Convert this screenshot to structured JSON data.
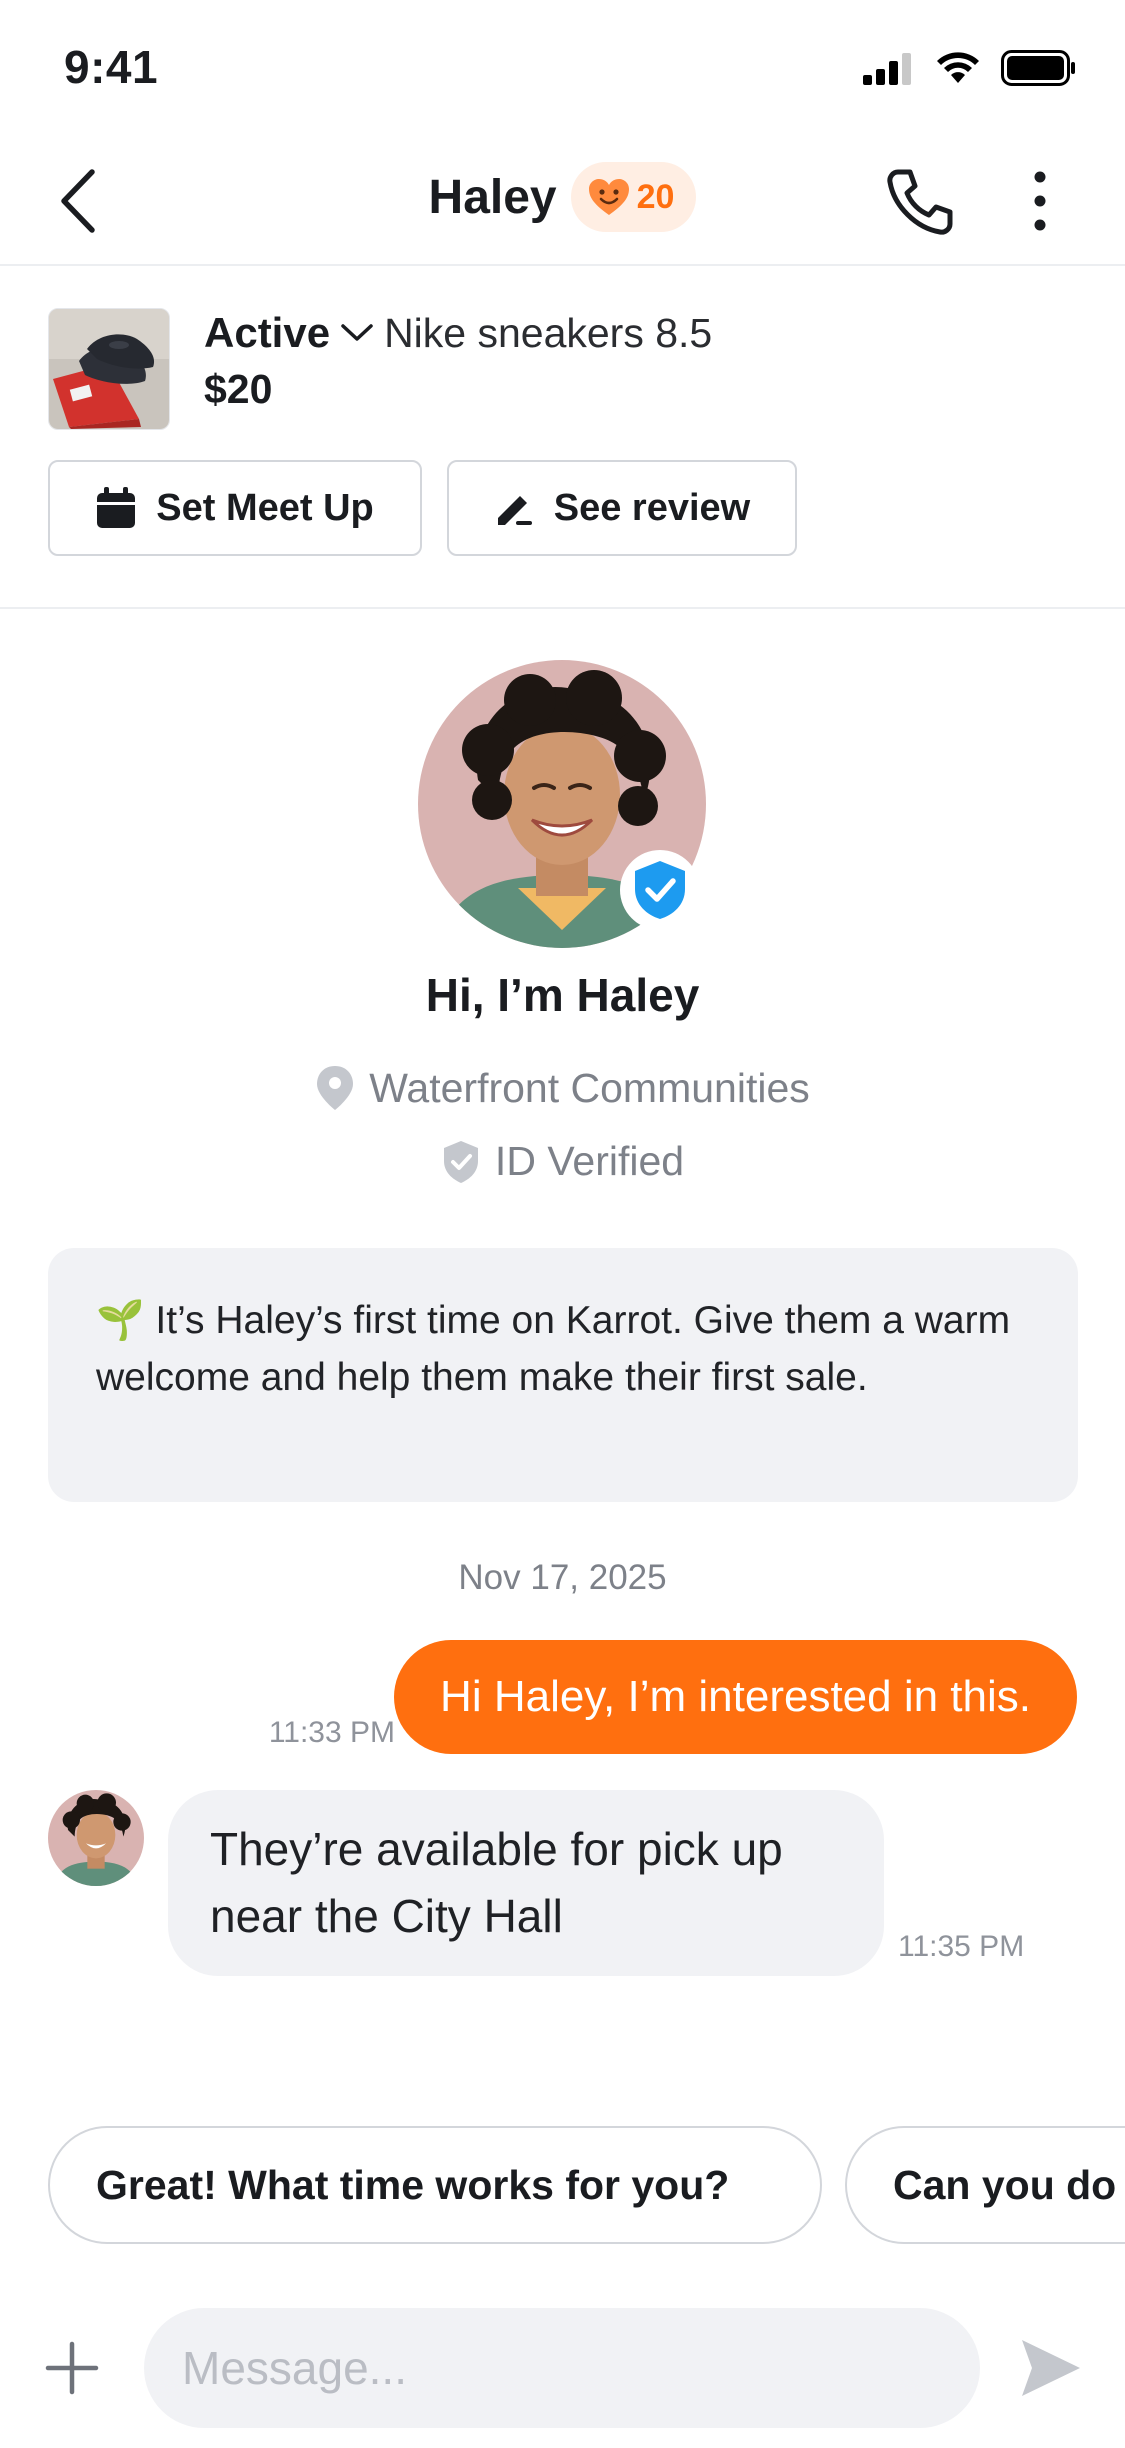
{
  "status_bar": {
    "time": "9:41"
  },
  "header": {
    "back_icon": "chevron-left-icon",
    "title": "Haley",
    "manner_temp": "20",
    "call_icon": "phone-icon",
    "more_icon": "more-vertical-icon"
  },
  "product": {
    "status": "Active",
    "title": "Nike sneakers 8.5",
    "price": "$20",
    "actions": {
      "meet_up": "Set Meet Up",
      "review": "See review"
    }
  },
  "profile": {
    "greeting": "Hi, I’m Haley",
    "location": "Waterfront Communities",
    "verified": "ID Verified"
  },
  "notice": {
    "emoji": "🌱",
    "text": "It’s Haley’s first time on Karrot. Give them a warm welcome and help them make their first sale."
  },
  "chat": {
    "date": "Nov 17, 2025",
    "messages": [
      {
        "from": "me",
        "text": "Hi Haley, I’m interested in this.",
        "time": "11:33 PM"
      },
      {
        "from": "Haley",
        "text": "They’re available for pick up near the City Hall",
        "time": "11:35 PM"
      }
    ]
  },
  "quick_replies": [
    "Great! What time works for you?",
    "Can you do"
  ],
  "composer": {
    "placeholder": "Message..."
  },
  "colors": {
    "accent": "#ff6f0f",
    "verified": "#1d9bf0",
    "bubble_in": "#f1f2f5"
  }
}
